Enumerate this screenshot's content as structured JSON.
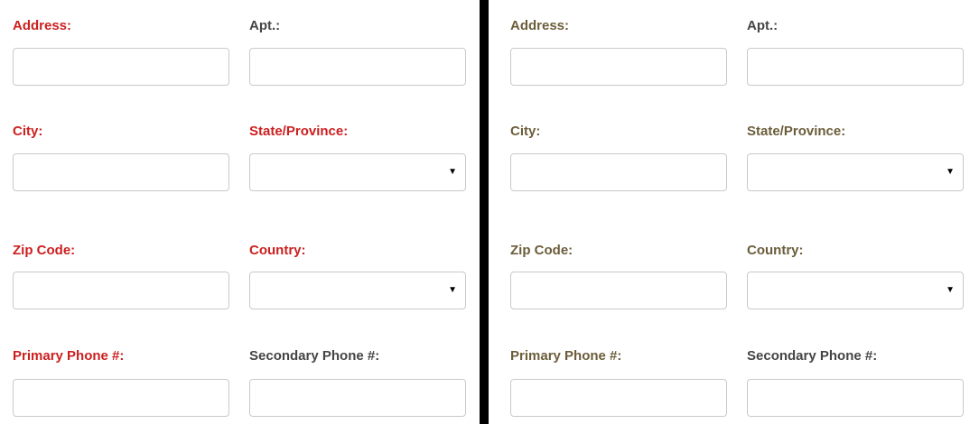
{
  "colors": {
    "required_label": "#cc1f1f",
    "normal_label": "#444444",
    "muted_label": "#6b5d3a",
    "divider": "#000000",
    "field_border": "#c9c9c9"
  },
  "left_form": {
    "address": {
      "label": "Address:",
      "value": ""
    },
    "apt": {
      "label": "Apt.:",
      "value": ""
    },
    "city": {
      "label": "City:",
      "value": ""
    },
    "state": {
      "label": "State/Province:",
      "selected": "",
      "icon": "dropdown-caret"
    },
    "zip": {
      "label": "Zip Code:",
      "value": ""
    },
    "country": {
      "label": "Country:",
      "selected": "",
      "icon": "dropdown-caret"
    },
    "primary_phone": {
      "label": "Primary Phone #:",
      "value": ""
    },
    "secondary_phone": {
      "label": "Secondary Phone #:",
      "value": ""
    }
  },
  "right_form": {
    "address": {
      "label": "Address:",
      "value": ""
    },
    "apt": {
      "label": "Apt.:",
      "value": ""
    },
    "city": {
      "label": "City:",
      "value": ""
    },
    "state": {
      "label": "State/Province:",
      "selected": "",
      "icon": "dropdown-caret"
    },
    "zip": {
      "label": "Zip Code:",
      "value": ""
    },
    "country": {
      "label": "Country:",
      "selected": "",
      "icon": "dropdown-caret"
    },
    "primary_phone": {
      "label": "Primary Phone #:",
      "value": ""
    },
    "secondary_phone": {
      "label": "Secondary Phone #:",
      "value": ""
    }
  },
  "caret_glyph": "▼"
}
